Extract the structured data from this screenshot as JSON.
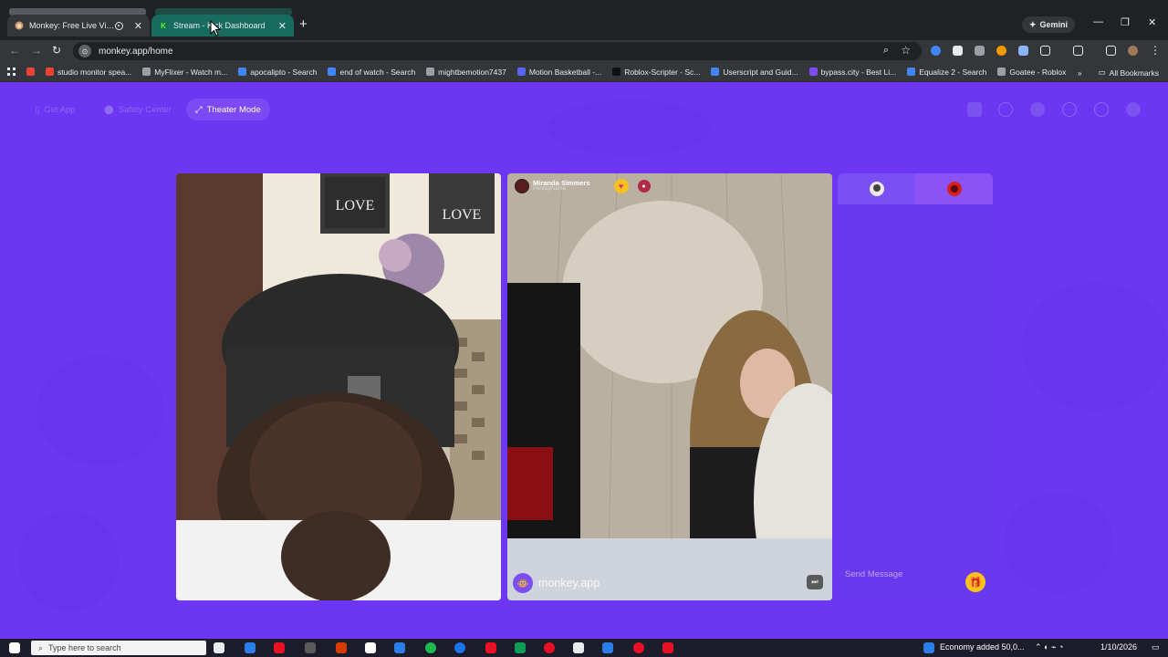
{
  "browser": {
    "tabs": [
      {
        "title": "Monkey: Free Live Video Ch",
        "active": true
      },
      {
        "title": "Stream - Kick Dashboard",
        "active": false
      }
    ],
    "gemini_label": "Gemini",
    "url": "monkey.app/home",
    "bookmarks": [
      {
        "label": "studio monitor spea...",
        "icon_color": "#ea4335"
      },
      {
        "label": "MyFlixer - Watch m...",
        "icon_color": "#9aa0a6"
      },
      {
        "label": "apocalipto - Search",
        "icon_color": "#4285f4"
      },
      {
        "label": "end of watch - Search",
        "icon_color": "#4285f4"
      },
      {
        "label": "mightbemotion7437",
        "icon_color": "#9aa0a6"
      },
      {
        "label": "Motion Basketball -...",
        "icon_color": "#5865f2"
      },
      {
        "label": "Roblox-Scripter - Sc...",
        "icon_color": "#111111"
      },
      {
        "label": "Userscript and Guid...",
        "icon_color": "#4285f4"
      },
      {
        "label": "bypass.city - Best Li...",
        "icon_color": "#7b4df2"
      },
      {
        "label": "Equalize 2 - Search",
        "icon_color": "#4285f4"
      },
      {
        "label": "Goatee - Roblox",
        "icon_color": "#9aa0a6"
      }
    ],
    "all_bookmarks": "All Bookmarks"
  },
  "page": {
    "get_app": "Get App",
    "safety_center": "Safety Center",
    "theater_mode": "Theater Mode",
    "remote_user": {
      "name": "Miranda Simmers",
      "location": "Pennsylvania"
    },
    "watermark": "monkey.app",
    "send_message_placeholder": "Send Message"
  },
  "taskbar": {
    "search_placeholder": "Type here to search",
    "news": "Economy added 50,0...",
    "date": "1/10/2026"
  }
}
